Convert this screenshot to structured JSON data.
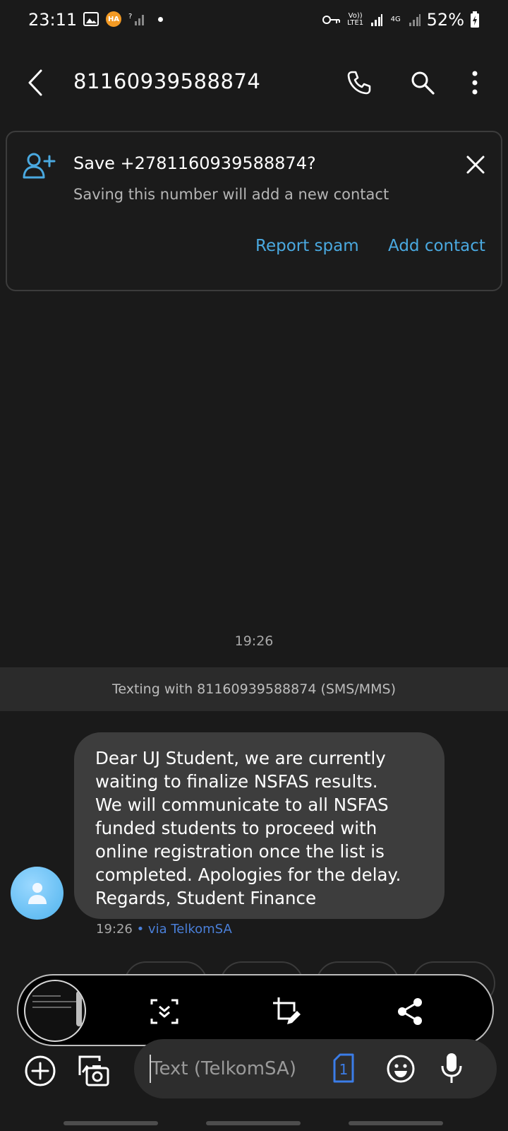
{
  "status_bar": {
    "time": "23:11",
    "notification_badge": "HA",
    "battery": "52%",
    "volte_label": "Vo)) LTE1",
    "network_label": "4G"
  },
  "header": {
    "title": "81160939588874",
    "icons": [
      "back-icon",
      "phone-icon",
      "search-icon",
      "more-vert-icon"
    ]
  },
  "save_card": {
    "title": "Save +2781160939588874?",
    "subtitle": "Saving this number will add a new contact",
    "report_spam_label": "Report spam",
    "add_contact_label": "Add contact",
    "accent_color": "#4aa9e0"
  },
  "conversation": {
    "timestamp": "19:26",
    "texting_with": "Texting with 81160939588874 (SMS/MMS)",
    "message": {
      "lines": [
        "Dear UJ Student, we are currently",
        "waiting to finalize NSFAS results.",
        "We will communicate to all NSFAS",
        "funded students to proceed with",
        "online registration once the list is",
        "completed. Apologies for the delay.",
        "Regards, Student Finance"
      ],
      "time": "19:26",
      "via": " • via TelkomSA"
    }
  },
  "screenshot_toolbar": {
    "icons": [
      "screenshot-thumbnail",
      "scroll-capture-icon",
      "crop-edit-icon",
      "share-icon"
    ]
  },
  "composer": {
    "placeholder": "Text (TelkomSA)",
    "sim_label": "1",
    "icons": [
      "add-icon",
      "gallery-camera-icon",
      "sim-icon",
      "emoji-icon",
      "mic-icon"
    ]
  }
}
